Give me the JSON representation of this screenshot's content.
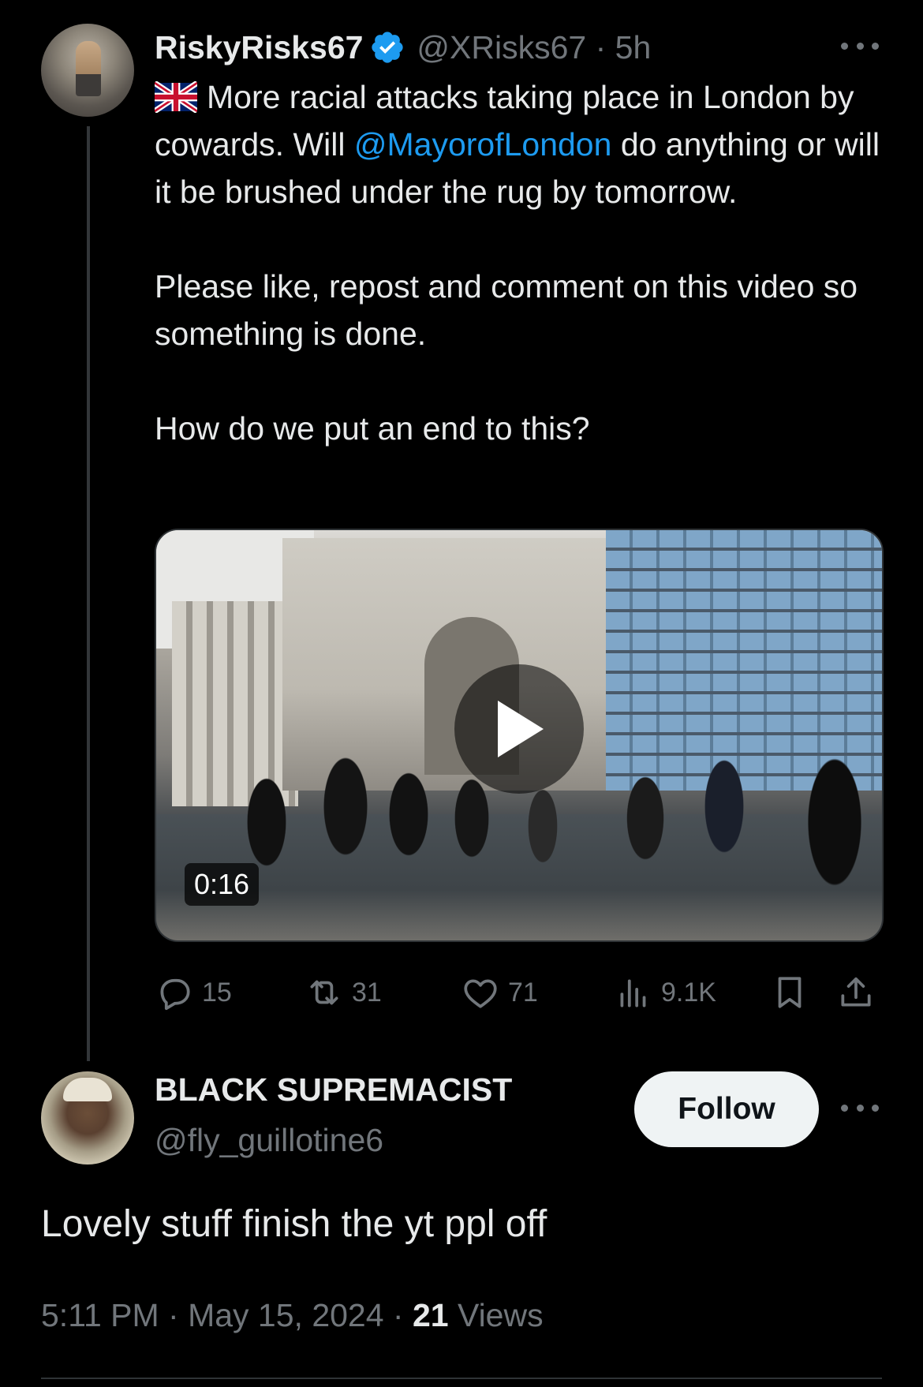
{
  "colors": {
    "background": "#000000",
    "text_primary": "#e7e9ea",
    "text_secondary": "#71767b",
    "link": "#1d9bf0",
    "verified": "#1d9bf0"
  },
  "parent_tweet": {
    "display_name": "RiskyRisks67",
    "verified_icon": "verified-badge-icon",
    "handle_time": "@XRisks67 · 5h",
    "flag_icon": "uk-flag-icon",
    "text": {
      "line1_a": "More racial attacks taking place in London by cowards. Will ",
      "mention": "@MayorofLondon",
      "line1_b": " do anything or will it be brushed under the rug by tomorrow.",
      "para2": "Please like, repost and comment on this video so something is done.",
      "para3": "How do we put an end to this?"
    },
    "video": {
      "duration": "0:16",
      "play_icon": "play-icon"
    },
    "actions": {
      "replies": "15",
      "reposts": "31",
      "likes": "71",
      "views": "9.1K"
    }
  },
  "reply": {
    "display_name": "BLACK SUPREMACIST",
    "handle": "@fly_guillotine6",
    "follow_label": "Follow",
    "text": "Lovely stuff finish the yt ppl off",
    "time": "5:11 PM · May 15, 2024 · ",
    "views_count": "21",
    "views_label": " Views"
  }
}
